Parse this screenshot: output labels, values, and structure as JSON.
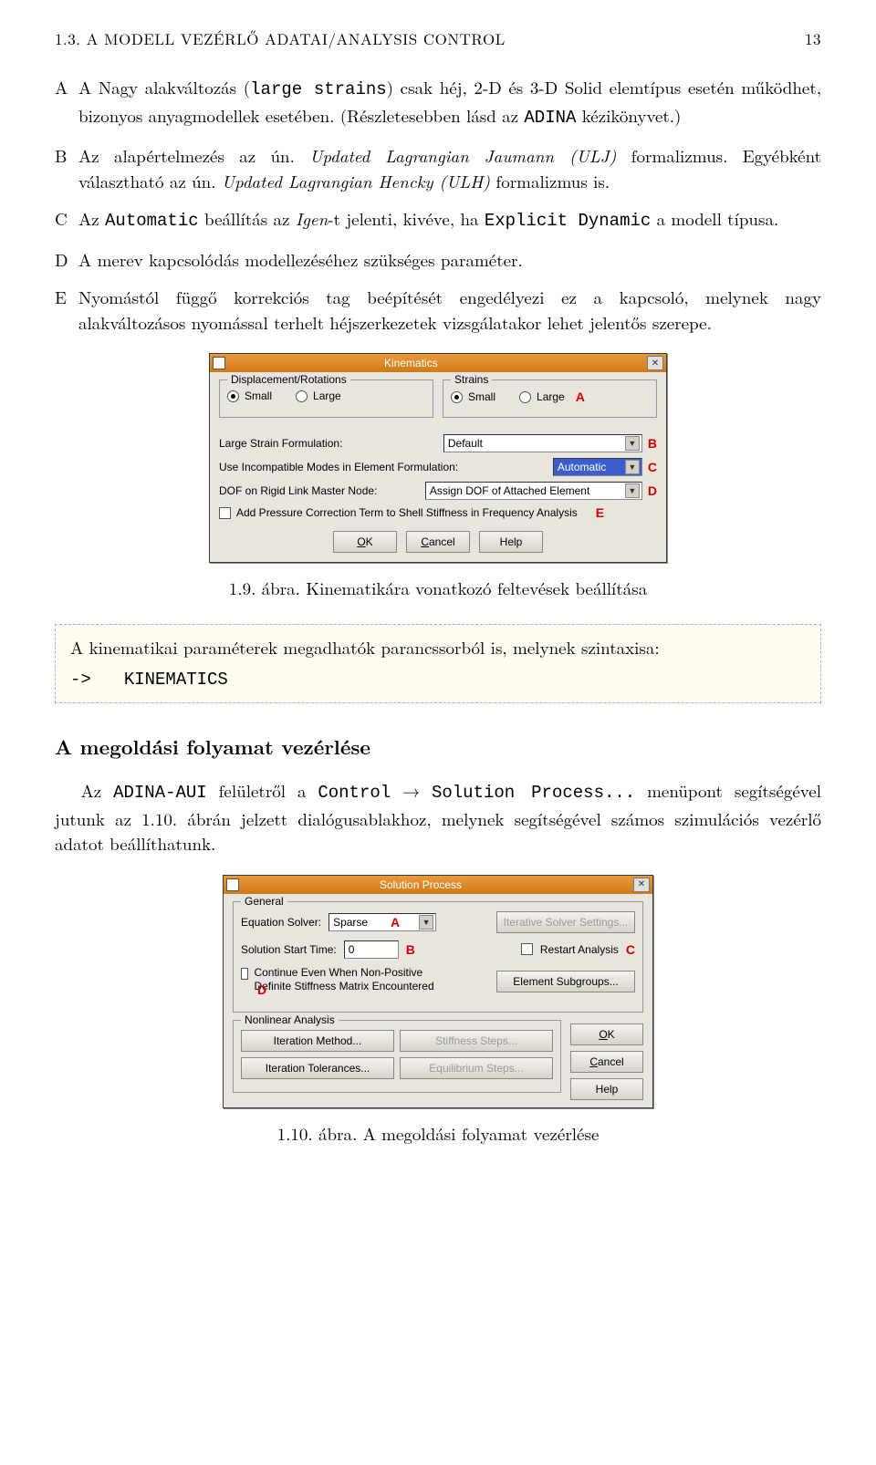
{
  "header": {
    "left": "1.3.  A MODELL VEZÉRLŐ ADATAI/ANALYSIS CONTROL",
    "page": "13"
  },
  "list": {
    "A": {
      "pre": "A Nagy alakváltozás (",
      "mono1": "large strains",
      "mid1": ") csak héj, 2-D és 3-D Solid elemtípus esetén működhet, bizonyos anyagmodellek esetében. (Részletesebben lásd az ",
      "mono2": "ADINA",
      "post": " kézikönyvet.)"
    },
    "B": "Az alapértelmezés az ún. Updated Lagrangian Jaumann (ULJ) formalizmus. Egyébként választható az ún. Updated Lagrangian Hencky (ULH) formalizmus is.",
    "C": {
      "pre": "Az ",
      "mono1": "Automatic",
      "mid1": " beállítás az ",
      "it1": "Igen",
      "mid2": "-t jelenti, kivéve, ha ",
      "mono2": "Explicit Dynamic",
      "post": " a modell típusa."
    },
    "D": "A merev kapcsolódás modellezéséhez szükséges paraméter.",
    "E": "Nyomástól függő korrekciós tag beépítését engedélyezi ez a kapcsoló, melynek nagy alakváltozásos nyomással terhelt héjszerkezetek vizsgálatakor lehet jelentős szerepe."
  },
  "kinematics": {
    "title": "Kinematics",
    "disp_legend": "Displacement/Rotations",
    "strains_legend": "Strains",
    "small": "Small",
    "large": "Large",
    "lsf_label": "Large Strain Formulation:",
    "lsf_value": "Default",
    "incomp_label": "Use Incompatible Modes in Element Formulation:",
    "incomp_value": "Automatic",
    "dof_label": "DOF on Rigid Link Master Node:",
    "dof_value": "Assign DOF of Attached Element",
    "press_label": "Add Pressure Correction Term to Shell Stiffness in Frequency Analysis",
    "ok": "OK",
    "cancel": "Cancel",
    "help": "Help",
    "annot": {
      "A": "A",
      "B": "B",
      "C": "C",
      "D": "D",
      "E": "E"
    }
  },
  "caption1": "1.9. ábra. Kinematikára vonatkozó feltevések beállítása",
  "note": {
    "line1": "A kinematikai paraméterek megadhatók parancssorból is, melynek szintaxisa:",
    "arrow": "->",
    "cmd": "KINEMATICS"
  },
  "section2": "A megoldási folyamat vezérlése",
  "para2": {
    "pre": "Az ",
    "mono1": "ADINA-AUI",
    "mid1": " felületről a ",
    "mono2": "Control",
    "arrow": " → ",
    "mono3": "Solution Process...",
    "post": " menüpont segítségével jutunk az 1.10. ábrán jelzett dialógusablakhoz, melynek segítségével számos szimulációs vezérlő adatot beállíthatunk."
  },
  "solution": {
    "title": "Solution Process",
    "general_legend": "General",
    "eq_label": "Equation Solver:",
    "eq_value": "Sparse",
    "iter_btn": "Iterative Solver Settings...",
    "sst_label": "Solution Start Time:",
    "sst_value": "0",
    "restart_label": "Restart Analysis",
    "cont_label": "Continue Even When Non-Positive Definite Stiffness Matrix Encountered",
    "elemsub_btn": "Element Subgroups...",
    "nonlin_legend": "Nonlinear Analysis",
    "itm_btn": "Iteration Method...",
    "itt_btn": "Iteration Tolerances...",
    "stiff_btn": "Stiffness Steps...",
    "equil_btn": "Equilibrium Steps...",
    "ok": "OK",
    "cancel": "Cancel",
    "help": "Help",
    "annot": {
      "A": "A",
      "B": "B",
      "C": "C",
      "D": "D"
    }
  },
  "caption2": "1.10. ábra. A megoldási folyamat vezérlése"
}
